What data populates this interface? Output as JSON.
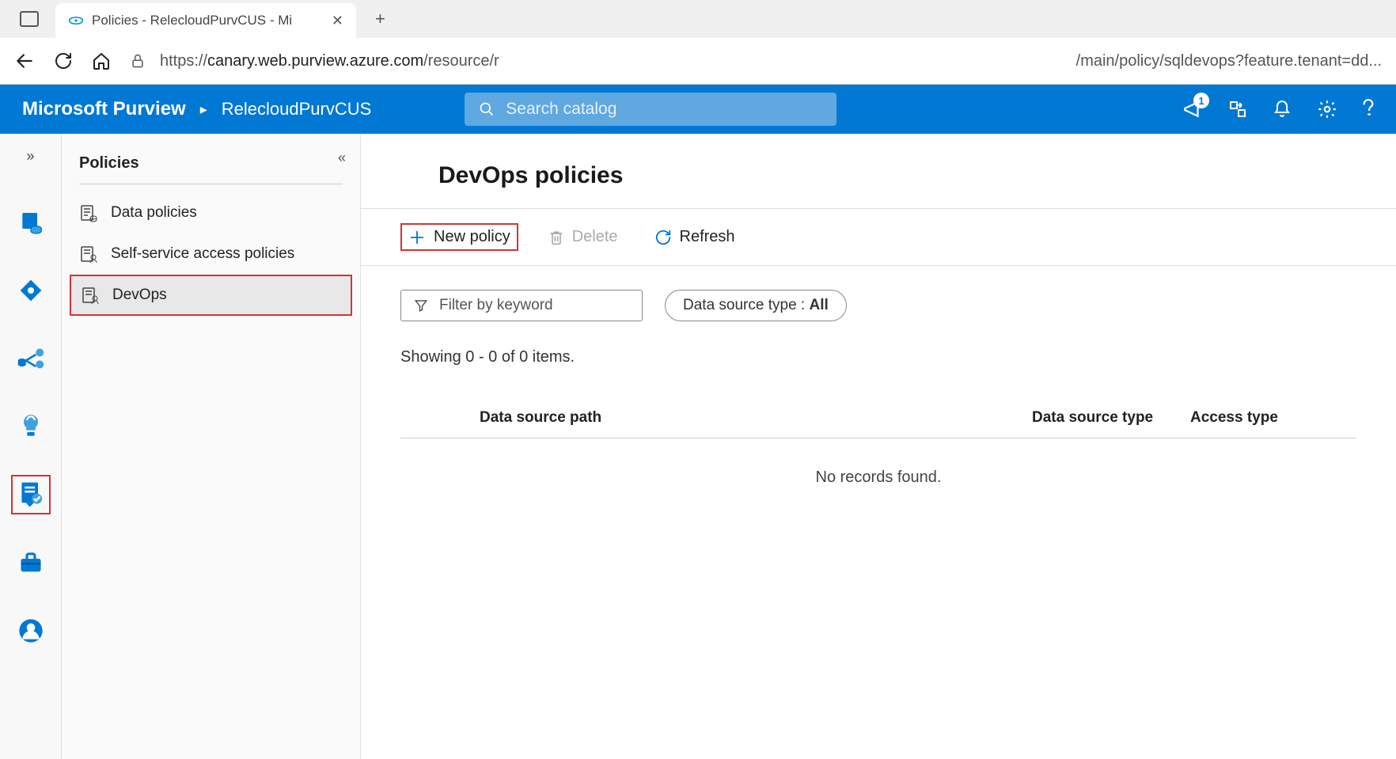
{
  "browser": {
    "tab_title": "Policies - RelecloudPurvCUS - Mi",
    "url_part1": "https://",
    "url_part2": "canary.web.purview.azure.com",
    "url_part3": "/resource/r",
    "url_part4": "/main/policy/sqldevops?feature.tenant=dd..."
  },
  "header": {
    "brand": "Microsoft Purview",
    "workspace": "RelecloudPurvCUS",
    "search_placeholder": "Search catalog",
    "notification_count": "1"
  },
  "sidebar": {
    "title": "Policies",
    "items": [
      {
        "label": "Data policies"
      },
      {
        "label": "Self-service access policies"
      },
      {
        "label": "DevOps"
      }
    ]
  },
  "content": {
    "title": "DevOps policies",
    "toolbar": {
      "new_policy": "New policy",
      "delete": "Delete",
      "refresh": "Refresh"
    },
    "filter_placeholder": "Filter by keyword",
    "source_filter_label": "Data source type : ",
    "source_filter_value": "All",
    "result_text": "Showing 0 - 0 of 0 items.",
    "columns": {
      "path": "Data source path",
      "type": "Data source type",
      "access": "Access type"
    },
    "empty": "No records found."
  }
}
